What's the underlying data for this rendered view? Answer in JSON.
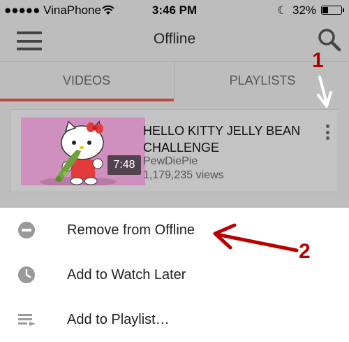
{
  "status_bar": {
    "carrier": "●●●●● VinaPhone",
    "time": "3:46 PM",
    "battery_percent": "32%",
    "icons": [
      "wifi-icon",
      "moon-icon",
      "battery-icon"
    ]
  },
  "app_bar": {
    "title": "Offline",
    "icons": [
      "menu-icon",
      "search-icon"
    ]
  },
  "tabs": [
    {
      "label": "VIDEOS",
      "active": true
    },
    {
      "label": "PLAYLISTS",
      "active": false
    }
  ],
  "video": {
    "title": "HELLO KITTY JELLY BEAN CHALLENGE",
    "channel": "PewDiePie",
    "views": "1,179,235 views",
    "duration": "7:48"
  },
  "action_sheet": {
    "items": [
      {
        "label": "Remove from Offline",
        "icon": "remove-circle-icon"
      },
      {
        "label": "Add to Watch Later",
        "icon": "clock-icon"
      },
      {
        "label": "Add to Playlist…",
        "icon": "playlist-add-icon"
      }
    ]
  },
  "annotations": {
    "step1": "1",
    "step2": "2"
  },
  "colors": {
    "tab_underline": "#b84a43",
    "annotation": "#b80000",
    "overlay": "#bdbdbd"
  }
}
